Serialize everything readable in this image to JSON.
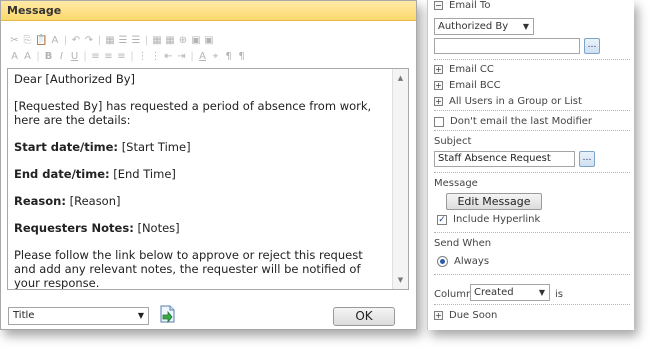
{
  "dialog": {
    "title": "Message",
    "toolbar_row1": [
      "✂",
      "⎘",
      "📋",
      "A",
      "↶",
      "↷",
      "▦",
      "☰",
      "☰",
      "▦",
      "▦",
      "⊕",
      "▣",
      "▣"
    ],
    "toolbar_row2": [
      "A",
      "A",
      "B",
      "I",
      "U",
      "≡",
      "≡",
      "≡",
      "⋮",
      "⋮",
      "⇤",
      "⇥",
      "A",
      "⌖",
      "¶",
      "¶"
    ],
    "body": {
      "greeting": "Dear [Authorized By]",
      "intro": "[Requested By] has requested a period of absence from work, here are the details:",
      "fields": [
        {
          "label": "Start date/time:",
          "value": "[Start Time]"
        },
        {
          "label": "End date/time:",
          "value": "[End Time]"
        },
        {
          "label": "Reason:",
          "value": "[Reason]"
        },
        {
          "label": "Requesters Notes:",
          "value": "[Notes]"
        }
      ],
      "closing": "Please follow the link below to approve or reject this request and add any relevant notes, the requester will be notified of your response."
    },
    "field_select": "Title",
    "ok_label": "OK"
  },
  "panel": {
    "email_to_label": "Email To",
    "authorized_by": "Authorized By",
    "email_to_value": "",
    "email_cc_label": "Email CC",
    "email_bcc_label": "Email BCC",
    "all_users_label": "All Users in a Group or List",
    "dont_email_label": "Don't email the last Modifier",
    "subject_label": "Subject",
    "subject_value": "Staff Absence Request",
    "message_label": "Message",
    "edit_message_label": "Edit Message",
    "include_hyperlink_label": "Include Hyperlink",
    "send_when_label": "Send When",
    "always_label": "Always",
    "column_label": "Column",
    "column_value": "Created",
    "is_label": "is",
    "due_soon_label": "Due Soon"
  }
}
